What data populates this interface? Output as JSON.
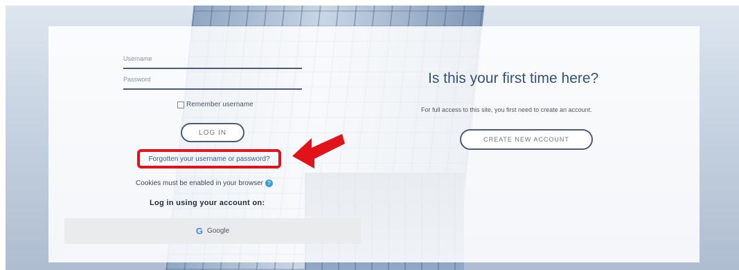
{
  "login": {
    "username_placeholder": "Username",
    "password_placeholder": "Password",
    "remember_label": "Remember username",
    "login_button": "LOG IN",
    "forgot_link": "Forgotten your username or password?",
    "cookies_notice": "Cookies must be enabled in your browser",
    "help_icon_glyph": "?",
    "login_with_heading": "Log in using your account on:",
    "google_button": "Google",
    "google_icon_glyph": "G"
  },
  "signup": {
    "heading": "Is this your first time here?",
    "description": "For full access to this site, you first need to create an account.",
    "create_button": "CREATE NEW ACCOUNT"
  },
  "annotation": {
    "highlight_color": "#e0131a",
    "arrow_color": "#e0131a"
  },
  "icons": {
    "help": "help-icon",
    "google": "google-icon",
    "arrow": "arrow-icon"
  }
}
